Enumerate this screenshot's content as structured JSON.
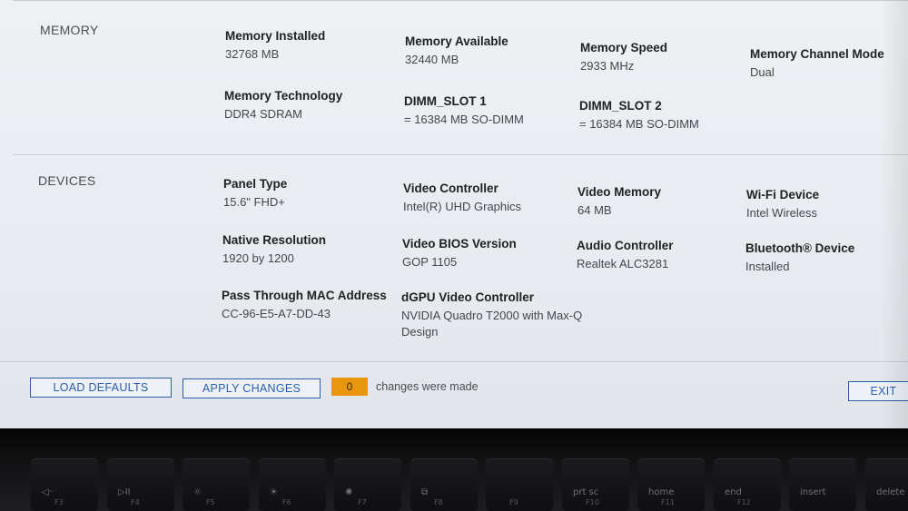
{
  "memory": {
    "section_label": "MEMORY",
    "items": [
      {
        "label": "Memory Installed",
        "value": "32768 MB"
      },
      {
        "label": "Memory Available",
        "value": "32440 MB"
      },
      {
        "label": "Memory Speed",
        "value": "2933 MHz"
      },
      {
        "label": "Memory Channel Mode",
        "value": "Dual"
      },
      {
        "label": "Memory Technology",
        "value": "DDR4 SDRAM"
      },
      {
        "label": "DIMM_SLOT 1",
        "value": "= 16384 MB SO-DIMM"
      },
      {
        "label": "DIMM_SLOT 2",
        "value": "= 16384 MB SO-DIMM"
      }
    ]
  },
  "devices": {
    "section_label": "DEVICES",
    "items": [
      {
        "label": "Panel Type",
        "value": "15.6\" FHD+"
      },
      {
        "label": "Video Controller",
        "value": "Intel(R) UHD Graphics"
      },
      {
        "label": "Video Memory",
        "value": "64 MB"
      },
      {
        "label": "Wi-Fi Device",
        "value": "Intel Wireless"
      },
      {
        "label": "Native Resolution",
        "value": "1920 by 1200"
      },
      {
        "label": "Video BIOS Version",
        "value": "GOP 1105"
      },
      {
        "label": "Audio Controller",
        "value": "Realtek ALC3281"
      },
      {
        "label": "Bluetooth® Device",
        "value": "Installed"
      },
      {
        "label": "Pass Through MAC Address",
        "value": "CC-96-E5-A7-DD-43"
      },
      {
        "label": "dGPU Video Controller",
        "value": "NVIDIA Quadro T2000 with Max-Q Design"
      }
    ]
  },
  "footer": {
    "load_defaults": "LOAD DEFAULTS",
    "apply_changes": "APPLY CHANGES",
    "changes_count": "0",
    "changes_text": "changes were made",
    "exit": "EXIT"
  },
  "keyboard": {
    "keys": [
      {
        "icon": "mute-icon",
        "glyph": "◁ᐧᐧ",
        "fn": "F3"
      },
      {
        "icon": "play-pause-icon",
        "glyph": "▷II",
        "fn": "F4"
      },
      {
        "icon": "brightness-down-icon",
        "glyph": "☼",
        "fn": "F5"
      },
      {
        "icon": "brightness-low-icon",
        "glyph": "☀",
        "fn": "F6"
      },
      {
        "icon": "brightness-up-icon",
        "glyph": "✺",
        "fn": "F7"
      },
      {
        "icon": "display-switch-icon",
        "glyph": "⧉",
        "fn": "F8"
      },
      {
        "icon": "blank-icon",
        "glyph": "",
        "fn": "F9"
      },
      {
        "icon": "print-screen-icon",
        "glyph": "prt sc",
        "fn": "F10"
      },
      {
        "icon": "home-icon",
        "glyph": "home",
        "fn": "F11"
      },
      {
        "icon": "end-icon",
        "glyph": "end",
        "fn": "F12"
      },
      {
        "icon": "insert-icon",
        "glyph": "insert",
        "fn": ""
      },
      {
        "icon": "delete-icon",
        "glyph": "delete",
        "fn": ""
      }
    ]
  }
}
